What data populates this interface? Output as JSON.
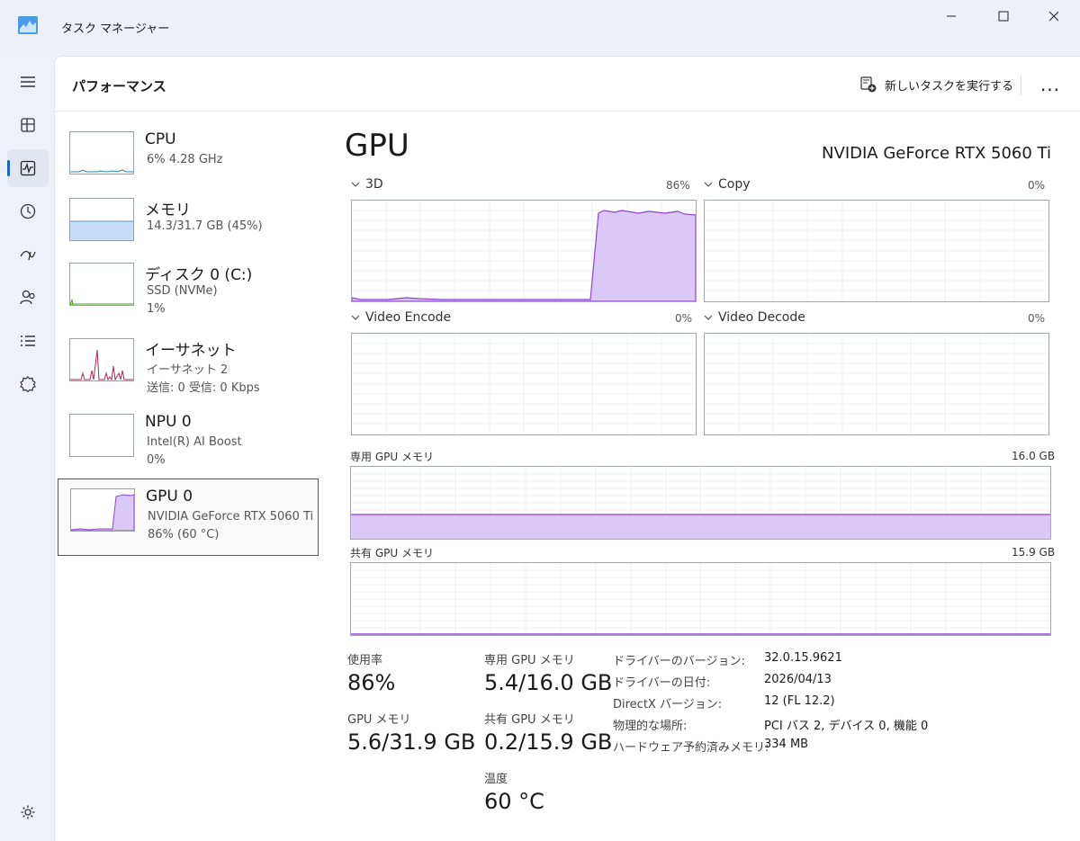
{
  "window": {
    "title": "タスク マネージャー"
  },
  "header": {
    "page_title": "パフォーマンス",
    "new_task_label": "新しいタスクを実行する",
    "more_label": "..."
  },
  "nav": {
    "items": [
      "menu-icon",
      "processes-icon",
      "performance-icon",
      "app-history-icon",
      "startup-apps-icon",
      "users-icon",
      "details-icon",
      "services-icon",
      "settings-icon"
    ],
    "active": "performance-icon"
  },
  "resources": [
    {
      "title": "CPU",
      "line1": "6%  4.28 GHz",
      "line2": ""
    },
    {
      "title": "メモリ",
      "line1": "14.3/31.7 GB (45%)",
      "line2": ""
    },
    {
      "title": "ディスク 0 (C:)",
      "line1": "SSD (NVMe)",
      "line2": "1%"
    },
    {
      "title": "イーサネット",
      "line1": "イーサネット 2",
      "line2": "送信: 0  受信: 0 Kbps"
    },
    {
      "title": "NPU 0",
      "line1": "Intel(R) AI Boost",
      "line2": "0%"
    },
    {
      "title": "GPU 0",
      "line1": "NVIDIA GeForce RTX 5060 Ti",
      "line2": "86% (60 °C)"
    }
  ],
  "detail": {
    "title": "GPU",
    "model": "NVIDIA GeForce RTX 5060 Ti",
    "graphs": [
      {
        "label": "3D",
        "value": "86%"
      },
      {
        "label": "Copy",
        "value": "0%"
      },
      {
        "label": "Video Encode",
        "value": "0%"
      },
      {
        "label": "Video Decode",
        "value": "0%"
      }
    ],
    "dedicated_label": "専用 GPU メモリ",
    "dedicated_max": "16.0 GB",
    "shared_label": "共有 GPU メモリ",
    "shared_max": "15.9 GB",
    "stats": {
      "usage_label": "使用率",
      "usage_value": "86%",
      "gpu_mem_label": "GPU メモリ",
      "gpu_mem_value": "5.6/31.9 GB",
      "dedicated_label": "専用 GPU メモリ",
      "dedicated_value": "5.4/16.0 GB",
      "shared_label": "共有 GPU メモリ",
      "shared_value": "0.2/15.9 GB",
      "temp_label": "温度",
      "temp_value": "60 °C"
    },
    "info": [
      {
        "key": "ドライバーのバージョン:",
        "value": "32.0.15.9621"
      },
      {
        "key": "ドライバーの日付:",
        "value": "2026/04/13"
      },
      {
        "key": "DirectX バージョン:",
        "value": "12 (FL 12.2)"
      },
      {
        "key": "物理的な場所:",
        "value": "PCI バス 2, デバイス 0, 機能 0"
      },
      {
        "key": "ハードウェア予約済みメモリ:",
        "value": "334 MB"
      }
    ]
  },
  "levels": {
    "dedicated_mem_fraction": 0.3375,
    "shared_mem_fraction": 0.013,
    "gpu_3d_percent": 86
  },
  "colors": {
    "gpu": "#8e44d8",
    "gpu_fill": "#dac8f6",
    "cpu": "#1f8ac0",
    "memory": "#5b8fd6",
    "memory_fill": "#c6dcf8",
    "disk": "#4b9a1c",
    "network": "#b4255a",
    "accent": "#1e64c8"
  }
}
